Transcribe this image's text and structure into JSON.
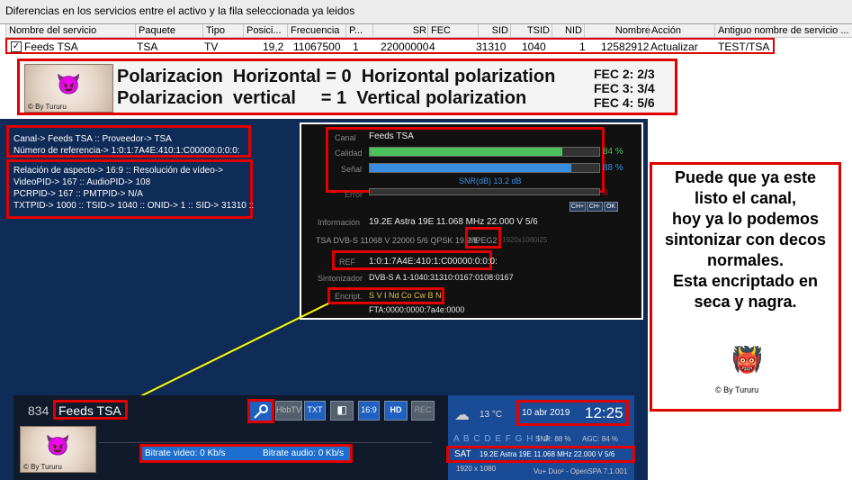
{
  "window_title": "Diferencias en los servicios entre el activo y la fila seleccionada ya leidos",
  "columns": [
    "Nombre del servicio",
    "Paquete",
    "Tipo",
    "Posici...",
    "Frecuencia",
    "P...",
    "SR",
    "FEC",
    "SID",
    "TSID",
    "NID",
    "Nombre",
    "Acción",
    "Antiguo nombre de servicio ..."
  ],
  "row": {
    "name": "Feeds TSA",
    "paquete": "TSA",
    "tipo": "TV",
    "posicion": "19,2",
    "frecuencia": "11067500",
    "p": "1",
    "sr": "22000000",
    "fec": "4",
    "sid": "31310",
    "tsid": "1040",
    "nid": "1",
    "nombre": "12582912",
    "accion": "Actualizar",
    "antiguo": "TEST/TSA"
  },
  "banner": {
    "line1": "Polarizacion  Horizontal = 0  Horizontal polarization",
    "line2": "Polarizacion  vertical     = 1  Vertical polarization",
    "fec_lines": [
      "FEC 2: 2/3",
      "FEC 3: 3/4",
      "FEC 4: 5/6"
    ],
    "logo_sig": "© By Tururu"
  },
  "channel_info": {
    "line1": "Canal-> Feeds TSA :: Proveedor-> TSA",
    "line2": "Número de referencia-> 1:0:1:7A4E:410:1:C00000:0:0:0:"
  },
  "pid_info": [
    "Relación de aspecto-> 16:9 :: Resolución de vídeo->",
    "VideoPID-> 167 :: AudioPID-> 108",
    "PCRPID-> 167 :: PMTPID-> N/A",
    "TXTPID-> 1000 :: TSID-> 1040 :: ONID-> 1 :: SID-> 31310 ::"
  ],
  "signal": {
    "canal_label": "Canal",
    "canal_value": "Feeds TSA",
    "calidad_label": "Calidad",
    "calidad_pct": "84 %",
    "calidad_fill": 0.84,
    "senal_label": "Señal",
    "senal_pct": "88 %",
    "senal_fill": 0.88,
    "snr": "SNR(dB) 13.2 dB",
    "error_label": "Error",
    "error_value": "0",
    "buttons": [
      "CH+",
      "CH-",
      "OK"
    ]
  },
  "details": {
    "info_label": "Información",
    "info_value": "19.2E Astra 19E 11.068 MHz 22.000 V 5/6",
    "tsa_line": "TSA DVB-S 11068 V 22000 5/6 QPSK 19.2°E",
    "mpeg": "MPEG2",
    "res": "1920x1080i25",
    "ref_label": "REF",
    "ref_value": "1:0:1:7A4E:410:1:C00000:0:0:0:",
    "tuner_label": "Sintonizador",
    "tuner_value": "DVB-S   A   1-1040:31310:0167:0108:0167",
    "encript_label": "Encript.",
    "encript_value": "S V I Nd Co Cw B N",
    "fta": "FTA:0000:0000:7a4e:0000"
  },
  "bottom": {
    "channel_number": "834",
    "channel_name": "Feeds TSA",
    "icons": [
      "key-icon",
      "hbbtv-icon",
      "txt-icon",
      "dolby-icon",
      "16:9",
      "HD",
      "REC"
    ],
    "icon_labels": {
      "hbbtv": "HbbTV",
      "txt": "TXT",
      "ratio": "16:9",
      "hd": "HD",
      "rec": "REC"
    },
    "bitrate_video": "Bitrate video:  0 Kb/s",
    "bitrate_audio": "Bitrate audio:  0 Kb/s",
    "weather": "13 °C",
    "date": "10 abr 2019",
    "time": "12:25",
    "letters": "A B C D E F G H I J",
    "snr": "SNR: 88 %",
    "agc": "AGC: 84 %",
    "sat_label": "SAT",
    "sat_value": "19.2E Astra 19E 11.068 MHz 22.000 V 5/6",
    "res": "1920 x 1080",
    "box": "Vu+ Duo² - OpenSPA 7.1.001"
  },
  "note": {
    "lines": [
      "Puede que ya este",
      "listo el canal,",
      "hoy ya lo podemos",
      "sintonizar con decos",
      "normales.",
      "Esta encriptado en",
      "seca y nagra."
    ],
    "sig": "© By Tururu"
  },
  "colors": {
    "highlight": "#e00000",
    "tv_bg": "#0f2b57",
    "quality_bar": "#4cc25a",
    "signal_bar": "#3a8ee0",
    "connector": "#ffff00"
  }
}
